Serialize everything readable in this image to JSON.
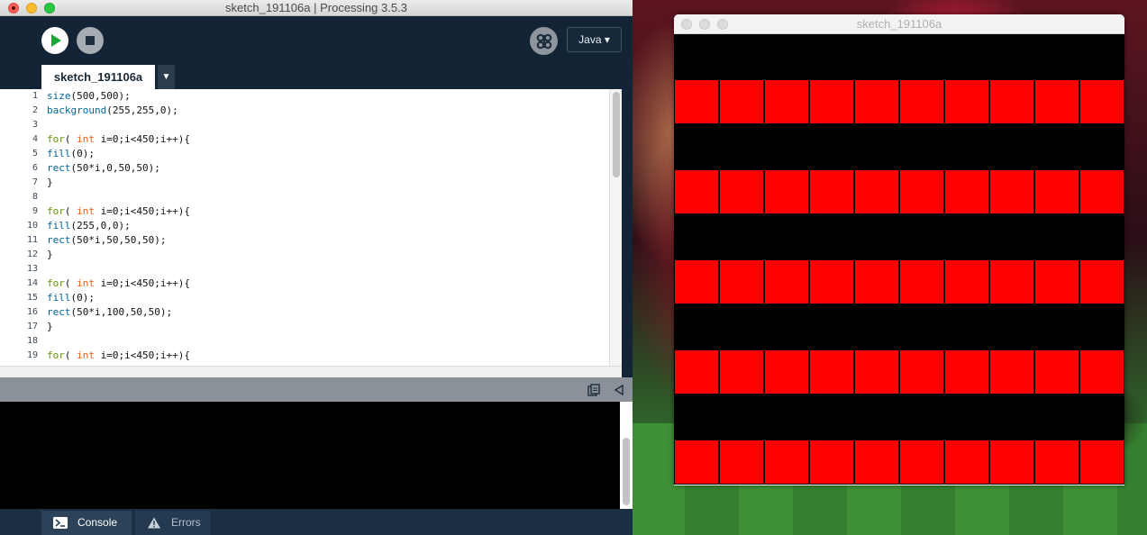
{
  "desktop": {},
  "ide": {
    "title": "sketch_191106a | Processing 3.5.3",
    "toolbar": {
      "run_icon": "play-icon",
      "stop_icon": "stop-icon",
      "debug_icon": "butterfly-icon",
      "mode_label": "Java ▾"
    },
    "tab": {
      "label": "sketch_191106a",
      "menu_label": "▼"
    },
    "code_lines": [
      {
        "num": "1",
        "parts": [
          [
            "fn",
            "size"
          ],
          [
            "p",
            "(500,500);"
          ]
        ]
      },
      {
        "num": "2",
        "parts": [
          [
            "fn",
            "background"
          ],
          [
            "p",
            "(255,255,0);"
          ]
        ]
      },
      {
        "num": "3",
        "parts": []
      },
      {
        "num": "4",
        "parts": [
          [
            "ctl",
            "for"
          ],
          [
            "p",
            "( "
          ],
          [
            "type",
            "int"
          ],
          [
            "p",
            " i=0;i<450;i++){"
          ]
        ]
      },
      {
        "num": "5",
        "parts": [
          [
            "fn",
            "fill"
          ],
          [
            "p",
            "(0);"
          ]
        ]
      },
      {
        "num": "6",
        "parts": [
          [
            "fn",
            "rect"
          ],
          [
            "p",
            "(50*i,0,50,50);"
          ]
        ]
      },
      {
        "num": "7",
        "parts": [
          [
            "p",
            "}"
          ]
        ]
      },
      {
        "num": "8",
        "parts": []
      },
      {
        "num": "9",
        "parts": [
          [
            "ctl",
            "for"
          ],
          [
            "p",
            "( "
          ],
          [
            "type",
            "int"
          ],
          [
            "p",
            " i=0;i<450;i++){"
          ]
        ]
      },
      {
        "num": "10",
        "parts": [
          [
            "fn",
            "fill"
          ],
          [
            "p",
            "(255,0,0);"
          ]
        ]
      },
      {
        "num": "11",
        "parts": [
          [
            "fn",
            "rect"
          ],
          [
            "p",
            "(50*i,50,50,50);"
          ]
        ]
      },
      {
        "num": "12",
        "parts": [
          [
            "p",
            "}"
          ]
        ]
      },
      {
        "num": "13",
        "parts": []
      },
      {
        "num": "14",
        "parts": [
          [
            "ctl",
            "for"
          ],
          [
            "p",
            "( "
          ],
          [
            "type",
            "int"
          ],
          [
            "p",
            " i=0;i<450;i++){"
          ]
        ]
      },
      {
        "num": "15",
        "parts": [
          [
            "fn",
            "fill"
          ],
          [
            "p",
            "(0);"
          ]
        ]
      },
      {
        "num": "16",
        "parts": [
          [
            "fn",
            "rect"
          ],
          [
            "p",
            "(50*i,100,50,50);"
          ]
        ]
      },
      {
        "num": "17",
        "parts": [
          [
            "p",
            "}"
          ]
        ]
      },
      {
        "num": "18",
        "parts": []
      },
      {
        "num": "19",
        "parts": [
          [
            "ctl",
            "for"
          ],
          [
            "p",
            "( "
          ],
          [
            "type",
            "int"
          ],
          [
            "p",
            " i=0;i<450;i++){"
          ]
        ]
      }
    ],
    "console": {
      "copy_icon": "copy-icon",
      "collapse_icon": "collapse-left-icon",
      "output": ""
    },
    "footer": {
      "console_label": "Console",
      "errors_label": "Errors",
      "console_icon": "terminal-icon",
      "errors_icon": "warning-icon"
    }
  },
  "sketch_window": {
    "title": "sketch_191106a",
    "canvas": {
      "columns": 10,
      "rows": [
        "black",
        "red",
        "black",
        "red",
        "black",
        "red",
        "black",
        "red",
        "black",
        "red"
      ],
      "colors": {
        "black": "#000000",
        "red": "#ff0000"
      }
    }
  }
}
